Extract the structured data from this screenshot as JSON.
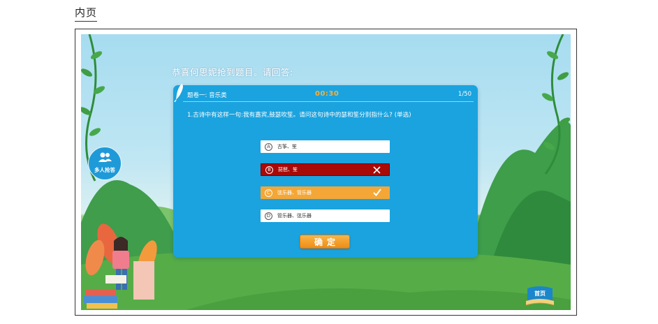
{
  "page": {
    "heading": "内页"
  },
  "screen": {
    "prompt": "恭喜何思妮抢到题目。请回答:",
    "panel": {
      "exam_title": "题卷一: 音乐类",
      "timer": "00:30",
      "progress": "1/50",
      "question": "1.古诗中有这样一句:我有嘉宾,鼓瑟吹笙。请问这句诗中的瑟和笙分别指什么? (单选)",
      "options": [
        {
          "letter": "A",
          "text": "古筝、笙",
          "state": "normal"
        },
        {
          "letter": "B",
          "text": "琵琶、笙",
          "state": "wrong"
        },
        {
          "letter": "C",
          "text": "弦乐器、管乐器",
          "state": "correct"
        },
        {
          "letter": "D",
          "text": "管乐器、弦乐器",
          "state": "normal"
        }
      ],
      "confirm_label": "确定"
    },
    "multi_answer_label": "多人抢答",
    "home_label": "首页"
  },
  "colors": {
    "panel": "#1aa3df",
    "timer": "#f6b03c",
    "wrong": "#a80a08",
    "correct": "#f4a736",
    "confirm": "#ef8c17"
  },
  "icons": {
    "pen": "quill-pen-icon",
    "wrong": "cross-icon",
    "correct": "checkmark-icon",
    "multi": "users-group-icon",
    "home": "book-icon"
  }
}
